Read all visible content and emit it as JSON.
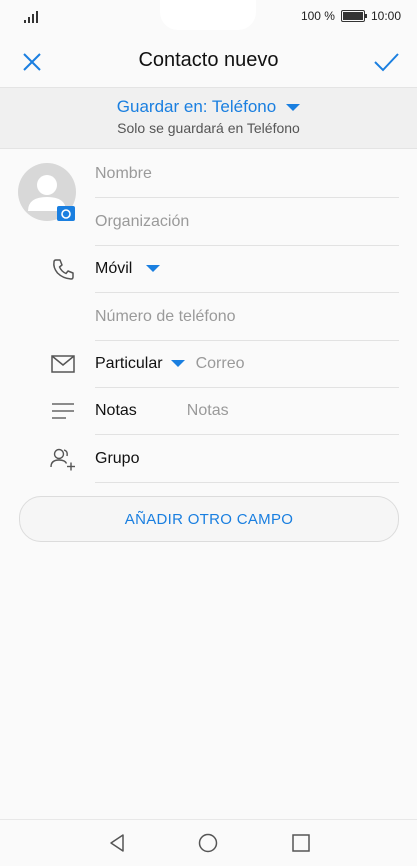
{
  "status_bar": {
    "battery_percent": "100 %",
    "time": "10:00"
  },
  "toolbar": {
    "title": "Contacto nuevo",
    "close_icon": "close-icon",
    "confirm_icon": "check-icon"
  },
  "save_location": {
    "label": "Guardar en: Teléfono",
    "subtitle": "Solo se guardará en Teléfono"
  },
  "form": {
    "name_placeholder": "Nombre",
    "organization_placeholder": "Organización",
    "phone_type": "Móvil",
    "phone_placeholder": "Número de teléfono",
    "email_type": "Particular",
    "email_placeholder": "Correo",
    "notes_label": "Notas",
    "notes_placeholder": "Notas",
    "group_label": "Grupo"
  },
  "add_field_button": "AÑADIR OTRO CAMPO",
  "colors": {
    "accent": "#1a7fe0",
    "background": "#fafafa",
    "band": "#f0f0f0"
  }
}
